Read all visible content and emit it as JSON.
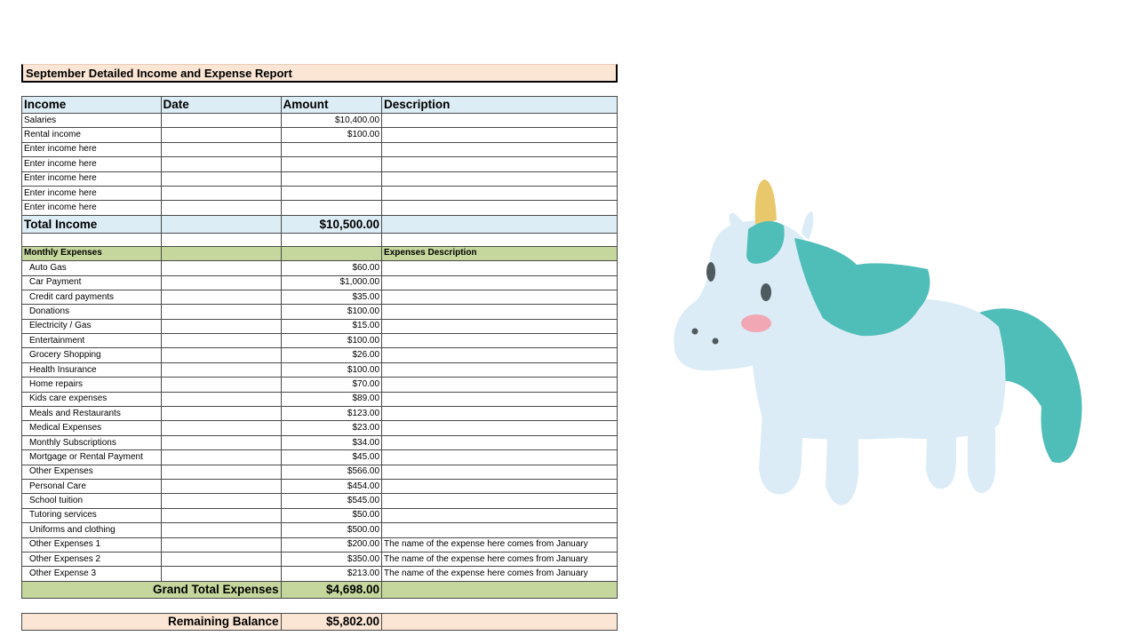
{
  "report": {
    "title": "September Detailed Income and Expense Report",
    "income_header": [
      "Income",
      "Date",
      "Amount",
      "Description"
    ],
    "income_rows": [
      {
        "label": "Salaries",
        "date": "",
        "amount": "$10,400.00",
        "desc": ""
      },
      {
        "label": "Rental income",
        "date": "",
        "amount": "$100.00",
        "desc": ""
      },
      {
        "label": "Enter income here",
        "date": "",
        "amount": "",
        "desc": ""
      },
      {
        "label": "Enter income here",
        "date": "",
        "amount": "",
        "desc": ""
      },
      {
        "label": "Enter income here",
        "date": "",
        "amount": "",
        "desc": ""
      },
      {
        "label": "Enter income here",
        "date": "",
        "amount": "",
        "desc": ""
      },
      {
        "label": "Enter income here",
        "date": "",
        "amount": "",
        "desc": ""
      }
    ],
    "total_income_label": "Total Income",
    "total_income": "$10,500.00",
    "expenses_header": {
      "label": "Monthly  Expenses",
      "desc": "Expenses Description"
    },
    "expense_rows": [
      {
        "label": "Auto Gas",
        "amount": "$60.00",
        "desc": ""
      },
      {
        "label": "Car Payment",
        "amount": "$1,000.00",
        "desc": ""
      },
      {
        "label": "Credit card payments",
        "amount": "$35.00",
        "desc": ""
      },
      {
        "label": "Donations",
        "amount": "$100.00",
        "desc": ""
      },
      {
        "label": "Electricity / Gas",
        "amount": "$15.00",
        "desc": ""
      },
      {
        "label": "Entertainment",
        "amount": "$100.00",
        "desc": ""
      },
      {
        "label": "Grocery Shopping",
        "amount": "$26.00",
        "desc": ""
      },
      {
        "label": "Health Insurance",
        "amount": "$100.00",
        "desc": ""
      },
      {
        "label": "Home repairs",
        "amount": "$70.00",
        "desc": ""
      },
      {
        "label": "Kids care expenses",
        "amount": "$89.00",
        "desc": ""
      },
      {
        "label": "Meals and Restaurants",
        "amount": "$123.00",
        "desc": ""
      },
      {
        "label": "Medical Expenses",
        "amount": "$23.00",
        "desc": ""
      },
      {
        "label": "Monthly Subscriptions",
        "amount": "$34.00",
        "desc": ""
      },
      {
        "label": "Mortgage or Rental Payment",
        "amount": "$45.00",
        "desc": ""
      },
      {
        "label": "Other Expenses",
        "amount": "$566.00",
        "desc": ""
      },
      {
        "label": "Personal Care",
        "amount": "$454.00",
        "desc": ""
      },
      {
        "label": "School tuition",
        "amount": "$545.00",
        "desc": ""
      },
      {
        "label": "Tutoring services",
        "amount": "$50.00",
        "desc": ""
      },
      {
        "label": "Uniforms and clothing",
        "amount": "$500.00",
        "desc": ""
      },
      {
        "label": "Other Expenses 1",
        "amount": "$200.00",
        "desc": "The name of the expense here comes from January"
      },
      {
        "label": "Other Expenses  2",
        "amount": "$350.00",
        "desc": "The name of the expense here comes from January"
      },
      {
        "label": "Other Expense 3",
        "amount": "$213.00",
        "desc": "The name of the expense here comes from January"
      }
    ],
    "grand_total_label": "Grand Total Expenses",
    "grand_total": "$4,698.00",
    "remaining_label": "Remaining Balance",
    "remaining": "$5,802.00"
  },
  "colors": {
    "title_bg": "#fbe6d5",
    "income_bg": "#dcedf5",
    "expense_bg": "#c5d79d",
    "unicorn_body": "#dbecf6",
    "unicorn_mane": "#4fbdb8",
    "unicorn_horn": "#e8c86a",
    "unicorn_cheek": "#f2a8b4"
  },
  "illustration": {
    "icon": "unicorn-icon"
  }
}
